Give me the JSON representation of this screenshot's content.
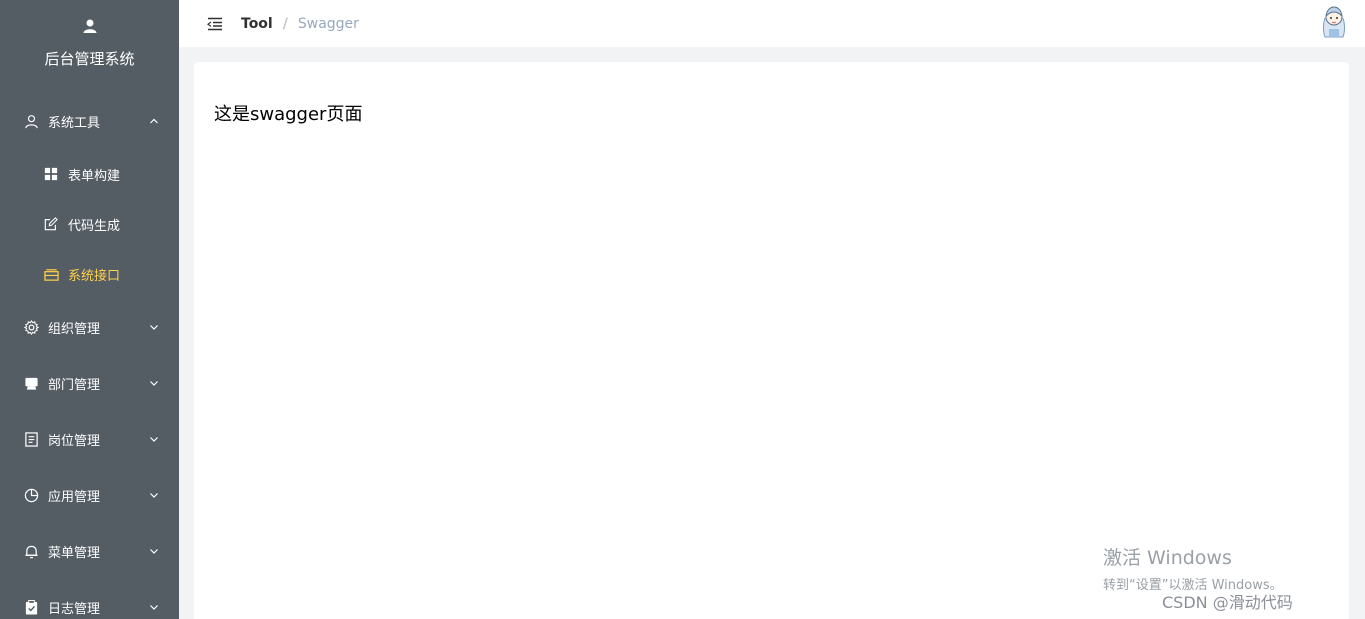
{
  "sidebar": {
    "brand_title": "后台管理系统",
    "groups": [
      {
        "label": "系统工具",
        "icon": "user-icon",
        "expanded": true,
        "children": [
          {
            "label": "表单构建",
            "icon": "grid-icon"
          },
          {
            "label": "代码生成",
            "icon": "edit-icon"
          },
          {
            "label": "系统接口",
            "icon": "tray-icon",
            "active": true
          }
        ]
      },
      {
        "label": "组织管理",
        "icon": "gear-icon"
      },
      {
        "label": "部门管理",
        "icon": "box-icon"
      },
      {
        "label": "岗位管理",
        "icon": "document-icon"
      },
      {
        "label": "应用管理",
        "icon": "pie-chart-icon"
      },
      {
        "label": "菜单管理",
        "icon": "bell-icon"
      },
      {
        "label": "日志管理",
        "icon": "clipboard-icon"
      }
    ],
    "colors": {
      "background": "#545c64",
      "text": "#ffffff",
      "active": "#ffd04b"
    }
  },
  "header": {
    "breadcrumb": [
      "Tool",
      "Swagger"
    ],
    "separator": "/"
  },
  "main": {
    "text": "这是swagger页面"
  },
  "overlay": {
    "windows_line1": "激活 Windows",
    "windows_line2": "转到“设置”以激活 Windows。",
    "csdn": "CSDN @滑动代码"
  }
}
